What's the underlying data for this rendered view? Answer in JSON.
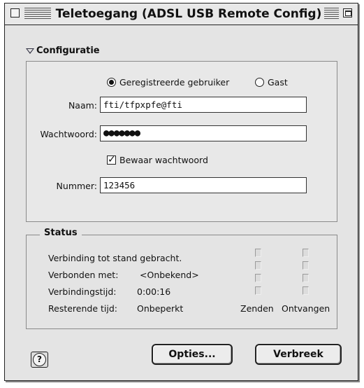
{
  "window": {
    "title": "Teletoegang (ADSL USB Remote Config)"
  },
  "config": {
    "header": "Configuratie",
    "radio_registered": "Geregistreerde gebruiker",
    "radio_guest": "Gast",
    "selected_mode": "Geregistreerde gebruiker",
    "name_label": "Naam:",
    "name_value": "fti/tfpxpfe@fti",
    "password_label": "Wachtwoord:",
    "password_value": "●●●●●●●",
    "save_password_label": "Bewaar wachtwoord",
    "save_password_checked": true,
    "number_label": "Nummer:",
    "number_value": "123456"
  },
  "status": {
    "header": "Status",
    "connection_text": "Verbinding tot stand gebracht.",
    "connected_label": "Verbonden met:",
    "connected_value": "<Onbekend>",
    "time_label": "Verbindingstijd:",
    "time_value": "0:00:16",
    "remaining_label": "Resterende tijd:",
    "remaining_value": "Onbeperkt",
    "send_label": "Zenden",
    "receive_label": "Ontvangen"
  },
  "buttons": {
    "help": "?",
    "options": "Opties...",
    "disconnect": "Verbreek"
  }
}
